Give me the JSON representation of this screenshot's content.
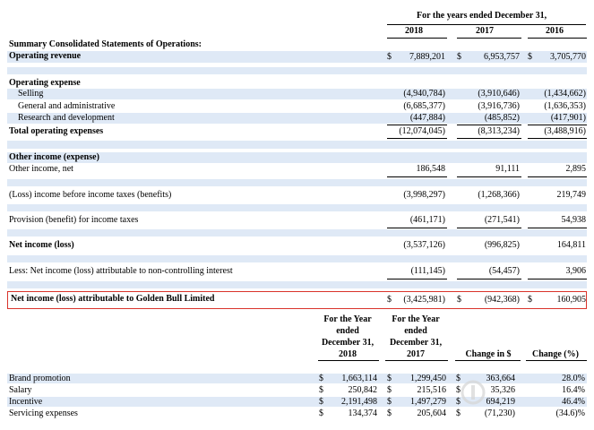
{
  "header": {
    "period_title": "For the years ended December 31,",
    "years": [
      "2018",
      "2017",
      "2016"
    ]
  },
  "sections": {
    "summary_title": "Summary Consolidated Statements of Operations:",
    "operating_expense": "Operating expense",
    "other_income": "Other income (expense)"
  },
  "currency_symbol": "$",
  "rows": {
    "operating_revenue": {
      "label": "Operating revenue",
      "v2018": "7,889,201",
      "v2017": "6,953,757",
      "v2016": "3,705,770"
    },
    "selling": {
      "label": "Selling",
      "v2018": "(4,940,784)",
      "v2017": "(3,910,646)",
      "v2016": "(1,434,662)"
    },
    "general_admin": {
      "label": "General and administrative",
      "v2018": "(6,685,377)",
      "v2017": "(3,916,736)",
      "v2016": "(1,636,353)"
    },
    "research_dev": {
      "label": "Research and development",
      "v2018": "(447,884)",
      "v2017": "(485,852)",
      "v2016": "(417,901)"
    },
    "total_opex": {
      "label": "Total operating expenses",
      "v2018": "(12,074,045)",
      "v2017": "(8,313,234)",
      "v2016": "(3,488,916)"
    },
    "other_income_net": {
      "label": "Other income, net",
      "v2018": "186,548",
      "v2017": "91,111",
      "v2016": "2,895"
    },
    "loss_before_tax": {
      "label": "(Loss) income before income taxes (benefits)",
      "v2018": "(3,998,297)",
      "v2017": "(1,268,366)",
      "v2016": "219,749"
    },
    "provision_tax": {
      "label": "Provision (benefit) for income taxes",
      "v2018": "(461,171)",
      "v2017": "(271,541)",
      "v2016": "54,938"
    },
    "net_income": {
      "label": "Net income (loss)",
      "v2018": "(3,537,126)",
      "v2017": "(996,825)",
      "v2016": "164,811"
    },
    "nci": {
      "label": "Less: Net income (loss) attributable to non-controlling interest",
      "v2018": "(111,145)",
      "v2017": "(54,457)",
      "v2016": "3,906"
    },
    "attributable": {
      "label": "Net  income (loss) attributable to Golden Bull Limited",
      "v2018": "(3,425,981)",
      "v2017": "(942,368)",
      "v2016": "160,905"
    }
  },
  "comparison": {
    "headers": {
      "fy2018": "For the Year\nended\nDecember 31,\n2018",
      "fy2017": "For the Year\nended\nDecember 31,\n2017",
      "change_usd": "Change in $",
      "change_pct": "Change (%)"
    },
    "rows": [
      {
        "label": "Brand promotion",
        "v2018": "1,663,114",
        "v2017": "1,299,450",
        "change": "363,664",
        "pct": "28.0%"
      },
      {
        "label": "Salary",
        "v2018": "250,842",
        "v2017": "215,516",
        "change": "35,326",
        "pct": "16.4%"
      },
      {
        "label": "Incentive",
        "v2018": "2,191,498",
        "v2017": "1,497,279",
        "change": "694,219",
        "pct": "46.4%"
      },
      {
        "label": "Servicing expenses",
        "v2018": "134,374",
        "v2017": "205,604",
        "change": "(71,230)",
        "pct": "(34.6)%"
      }
    ]
  }
}
